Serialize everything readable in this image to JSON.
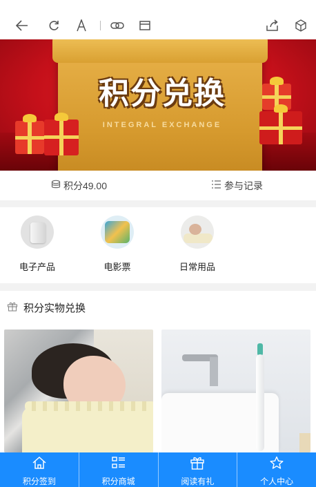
{
  "toolbar": {
    "icons": [
      "back-arrow-icon",
      "refresh-icon",
      "font-size-icon",
      "link-icon",
      "window-icon",
      "share-icon",
      "cube-icon"
    ]
  },
  "banner": {
    "title": "积分兑换",
    "subtitle": "INTEGRAL EXCHANGE"
  },
  "points": {
    "balance_label": "积分49.00",
    "records_label": "参与记录"
  },
  "categories": [
    {
      "label": "电子产品",
      "icon": "speaker-product-image"
    },
    {
      "label": "电影票",
      "icon": "movie-ticket-image"
    },
    {
      "label": "日常用品",
      "icon": "pillow-image"
    }
  ],
  "section": {
    "title": "积分实物兑换",
    "products": [
      {
        "image": "latex-pillow-photo"
      },
      {
        "image": "electric-toothbrush-photo"
      }
    ]
  },
  "tabbar": {
    "tabs": [
      {
        "label": "积分签到",
        "icon": "home-icon"
      },
      {
        "label": "积分商城",
        "icon": "list-icon"
      },
      {
        "label": "阅读有礼",
        "icon": "gift-icon"
      },
      {
        "label": "个人中心",
        "icon": "star-icon"
      }
    ]
  },
  "colors": {
    "tabbar_bg": "#1a8cff",
    "banner_red": "#c5101a",
    "banner_gold": "#d69a2e"
  }
}
